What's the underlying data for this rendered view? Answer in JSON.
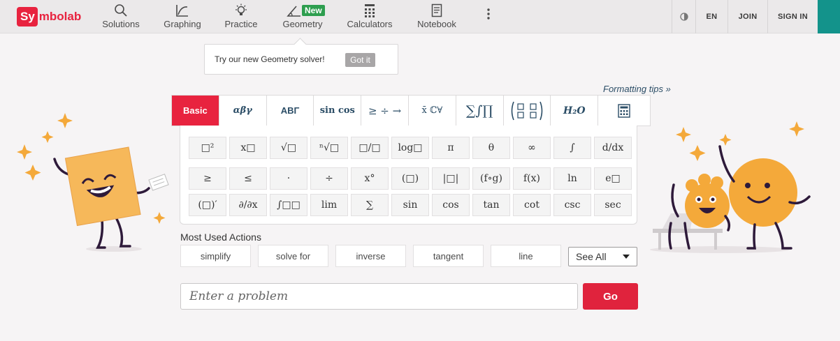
{
  "header": {
    "logo": {
      "box": "Sy",
      "rest": "mbolab"
    },
    "nav": [
      {
        "label": "Solutions",
        "icon": "search-icon"
      },
      {
        "label": "Graphing",
        "icon": "graph-icon"
      },
      {
        "label": "Practice",
        "icon": "lightbulb-icon"
      },
      {
        "label": "Geometry",
        "icon": "angle-icon",
        "badge": "New"
      },
      {
        "label": "Calculators",
        "icon": "calculator-icon"
      },
      {
        "label": "Notebook",
        "icon": "notebook-icon"
      }
    ],
    "more_icon": "more-vertical-icon",
    "theme_icon": "contrast-icon",
    "language": "EN",
    "join": "JOIN",
    "signin": "SIGN IN"
  },
  "toast": {
    "text": "Try our new Geometry solver!",
    "button": "Got it"
  },
  "formatting_tips": "Formatting tips »",
  "keypad": {
    "tabs": [
      "Basic",
      "αβγ",
      "ΑΒΓ",
      "sin cos",
      "≥ ÷ →",
      "x̄ ℂ∀",
      "∑∫∏",
      "matrix",
      "H₂O",
      "calculator"
    ],
    "active_tab": "Basic",
    "rows": [
      [
        "□²",
        "x□",
        "√□",
        "ⁿ√□",
        "□/□",
        "log□",
        "π",
        "θ",
        "∞",
        "∫",
        "d/dx"
      ],
      [
        "≥",
        "≤",
        "·",
        "÷",
        "x°",
        "(□)",
        "|□|",
        "(f∘g)",
        "f(x)",
        "ln",
        "e□"
      ],
      [
        "(□)′",
        "∂/∂x",
        "∫□□",
        "lim",
        "∑",
        "sin",
        "cos",
        "tan",
        "cot",
        "csc",
        "sec"
      ]
    ]
  },
  "actions": {
    "title": "Most Used Actions",
    "items": [
      "simplify",
      "solve for",
      "inverse",
      "tangent",
      "line"
    ],
    "see_all": "See All"
  },
  "input": {
    "placeholder": "Enter a problem",
    "go": "Go"
  },
  "colors": {
    "brand": "#e8233f",
    "teal": "#13938b",
    "new_badge": "#2e9e4f",
    "key_text": "#2b4d66"
  }
}
